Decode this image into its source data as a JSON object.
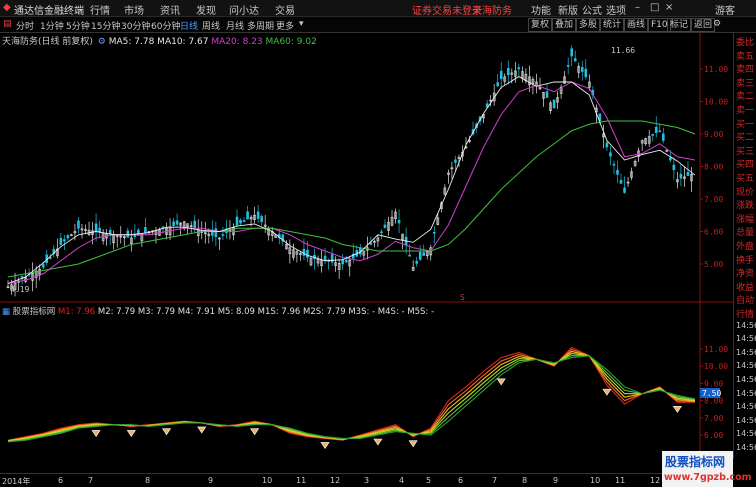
{
  "menubar": {
    "app_name": "通达信金融终端",
    "menus": [
      "行情",
      "市场",
      "资讯",
      "发现",
      "问小达",
      "交易"
    ],
    "notice": "证券交易未登录",
    "stock": "天海防务",
    "right": [
      "功能",
      "新版",
      "公式",
      "选项"
    ],
    "user": "游客"
  },
  "toolbar": {
    "periods": [
      "分时",
      "1分钟",
      "5分钟",
      "15分钟",
      "30分钟",
      "60分钟",
      "日线",
      "周线",
      "月线",
      "多周期",
      "更多"
    ],
    "active_period": "日线",
    "right_buttons": [
      "复权",
      "叠加",
      "多股",
      "统计",
      "画线",
      "F10",
      "标记",
      "返回"
    ]
  },
  "main_legend": {
    "title": "天海防务(日线 前复权)",
    "ma": [
      {
        "label": "MA5: 7.78",
        "color": "#e8e8e8"
      },
      {
        "label": "MA10: 7.67",
        "color": "#e8e8e8"
      },
      {
        "label": "MA20: 8.23",
        "color": "#d040d0"
      },
      {
        "label": "MA60: 9.02",
        "color": "#40c040"
      }
    ]
  },
  "main_axis": {
    "ticks": [
      "11.00",
      "10.00",
      "9.00",
      "8.00",
      "7.00",
      "6.00",
      "5.00"
    ],
    "high_label": "11.66",
    "low_label": "4.19",
    "marker": "S"
  },
  "sub_legend": {
    "title": "股票指标网",
    "items": [
      {
        "label": "M1: 7.96",
        "color": "#e02020"
      },
      {
        "label": "M2: 7.79",
        "color": "#e0e0e0"
      },
      {
        "label": "M3: 7.79",
        "color": "#e0e0e0"
      },
      {
        "label": "M4: 7.91",
        "color": "#e0e0e0"
      },
      {
        "label": "M5: 8.09",
        "color": "#e0e0e0"
      },
      {
        "label": "M1S: 7.96",
        "color": "#e0e0e0"
      },
      {
        "label": "M2S: 7.79",
        "color": "#e0e0e0"
      },
      {
        "label": "M3S: -",
        "color": "#e0e0e0"
      },
      {
        "label": "M4S: -",
        "color": "#e0e0e0"
      },
      {
        "label": "M5S: -",
        "color": "#e0e0e0"
      }
    ]
  },
  "sub_axis": {
    "ticks": [
      "11.00",
      "10.00",
      "9.00",
      "8.00",
      "7.00",
      "6.00"
    ],
    "current": "7.50"
  },
  "side_panel": [
    "委比",
    "卖五",
    "卖四",
    "卖三",
    "卖二",
    "卖一",
    "买一",
    "买二",
    "买三",
    "买四",
    "买五",
    "现价",
    "涨跌",
    "涨幅",
    "总量",
    "外盘",
    "换手",
    "净资",
    "收益",
    "自动",
    "行情",
    "14:56",
    "14:56",
    "14:56",
    "14:56",
    "14:56",
    "14:56",
    "14:56",
    "14:56",
    "14:56",
    "14:56"
  ],
  "dates": [
    "2014年",
    "6",
    "7",
    "8",
    "9",
    "10",
    "11",
    "12",
    "3",
    "4",
    "5",
    "6",
    "7",
    "8",
    "9",
    "10",
    "11",
    "12",
    "1",
    "2"
  ],
  "watermark": {
    "line1": "股票指标网",
    "line2": "www.7gpzb.com"
  },
  "chart_data": {
    "type": "line",
    "title": "天海防务(日线 前复权)",
    "ylim": [
      4.0,
      12.0
    ],
    "x_labels": [
      "2014年",
      "6",
      "7",
      "8",
      "9",
      "10",
      "11",
      "12",
      "3",
      "4",
      "5",
      "6",
      "7",
      "8",
      "9",
      "10",
      "11",
      "12",
      "1",
      "2"
    ],
    "series": [
      {
        "name": "close",
        "values": [
          4.3,
          4.6,
          4.9,
          5.6,
          6.1,
          6.0,
          5.9,
          5.8,
          6.0,
          6.1,
          6.3,
          6.0,
          5.8,
          6.2,
          6.5,
          6.0,
          5.5,
          5.2,
          5.1,
          5.0,
          5.3,
          5.8,
          6.6,
          4.9,
          5.5,
          7.8,
          8.6,
          9.6,
          10.7,
          11.0,
          10.6,
          9.8,
          11.4,
          10.6,
          8.6,
          7.2,
          8.8,
          9.1,
          7.6,
          7.8
        ]
      },
      {
        "name": "MA20",
        "values": [
          4.4,
          4.5,
          4.7,
          5.1,
          5.5,
          5.8,
          5.9,
          5.9,
          5.9,
          6.0,
          6.1,
          6.1,
          6.0,
          6.0,
          6.1,
          6.1,
          5.9,
          5.6,
          5.4,
          5.2,
          5.1,
          5.3,
          5.7,
          5.5,
          5.4,
          6.2,
          7.4,
          8.6,
          9.6,
          10.3,
          10.5,
          10.3,
          10.6,
          10.4,
          9.5,
          8.3,
          8.4,
          8.7,
          8.3,
          8.2
        ]
      },
      {
        "name": "MA60",
        "values": [
          4.6,
          4.7,
          4.8,
          4.9,
          5.0,
          5.2,
          5.4,
          5.6,
          5.7,
          5.8,
          5.9,
          6.0,
          6.0,
          6.1,
          6.1,
          6.1,
          6.0,
          5.9,
          5.8,
          5.6,
          5.5,
          5.4,
          5.4,
          5.4,
          5.4,
          5.6,
          6.1,
          6.7,
          7.3,
          7.8,
          8.3,
          8.7,
          9.1,
          9.3,
          9.4,
          9.4,
          9.4,
          9.3,
          9.2,
          9.0
        ]
      }
    ],
    "sub_series": [
      {
        "name": "M1",
        "values": [
          5.7,
          5.9,
          6.1,
          6.4,
          6.6,
          6.7,
          6.6,
          6.5,
          6.6,
          6.7,
          6.8,
          6.7,
          6.5,
          6.6,
          6.8,
          6.6,
          6.1,
          5.9,
          5.8,
          5.7,
          6.0,
          6.3,
          6.6,
          5.9,
          6.4,
          8.0,
          8.8,
          9.7,
          10.5,
          10.8,
          10.4,
          10.0,
          11.1,
          10.6,
          8.9,
          7.8,
          8.4,
          8.8,
          7.9,
          7.9
        ]
      },
      {
        "name": "M5",
        "values": [
          5.6,
          5.7,
          5.9,
          6.1,
          6.4,
          6.5,
          6.6,
          6.6,
          6.5,
          6.6,
          6.7,
          6.7,
          6.6,
          6.5,
          6.6,
          6.6,
          6.4,
          6.1,
          5.9,
          5.8,
          5.8,
          6.0,
          6.2,
          6.1,
          6.0,
          6.8,
          7.7,
          8.6,
          9.5,
          10.2,
          10.4,
          10.2,
          10.5,
          10.6,
          9.8,
          8.8,
          8.4,
          8.6,
          8.3,
          8.1
        ]
      }
    ]
  }
}
